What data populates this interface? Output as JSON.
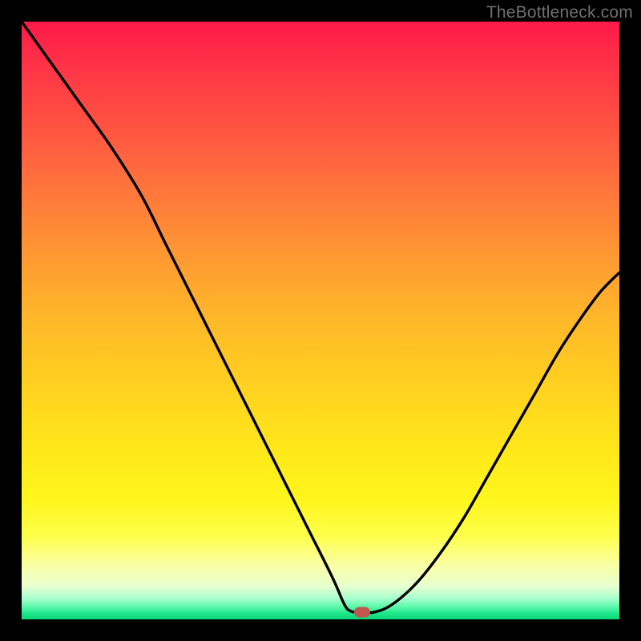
{
  "watermark": {
    "text": "TheBottleneck.com"
  },
  "colors": {
    "frame_bg": "#000000",
    "curve_stroke": "#000000",
    "marker_fill": "#c1564e",
    "watermark_color": "#6f6f6f"
  },
  "chart_data": {
    "type": "line",
    "title": "",
    "xlabel": "",
    "ylabel": "",
    "xlim": [
      0,
      100
    ],
    "ylim": [
      0,
      100
    ],
    "grid": false,
    "legend": null,
    "annotations": [
      {
        "kind": "marker",
        "x": 57,
        "y": 1.2
      }
    ],
    "series": [
      {
        "name": "bottleneck-curve",
        "x": [
          0,
          5,
          10,
          15,
          20,
          24,
          28,
          32,
          36,
          40,
          44,
          48,
          52,
          54,
          55,
          56,
          57,
          59,
          62,
          66,
          70,
          74,
          78,
          82,
          86,
          90,
          94,
          97,
          100
        ],
        "y": [
          100,
          93,
          86,
          79,
          71,
          63,
          55,
          47,
          39,
          31,
          23,
          15,
          7,
          2.5,
          1.4,
          1.2,
          1.2,
          1.2,
          2.5,
          6,
          11,
          17,
          24,
          31,
          38,
          45,
          51,
          55,
          58
        ]
      }
    ]
  }
}
